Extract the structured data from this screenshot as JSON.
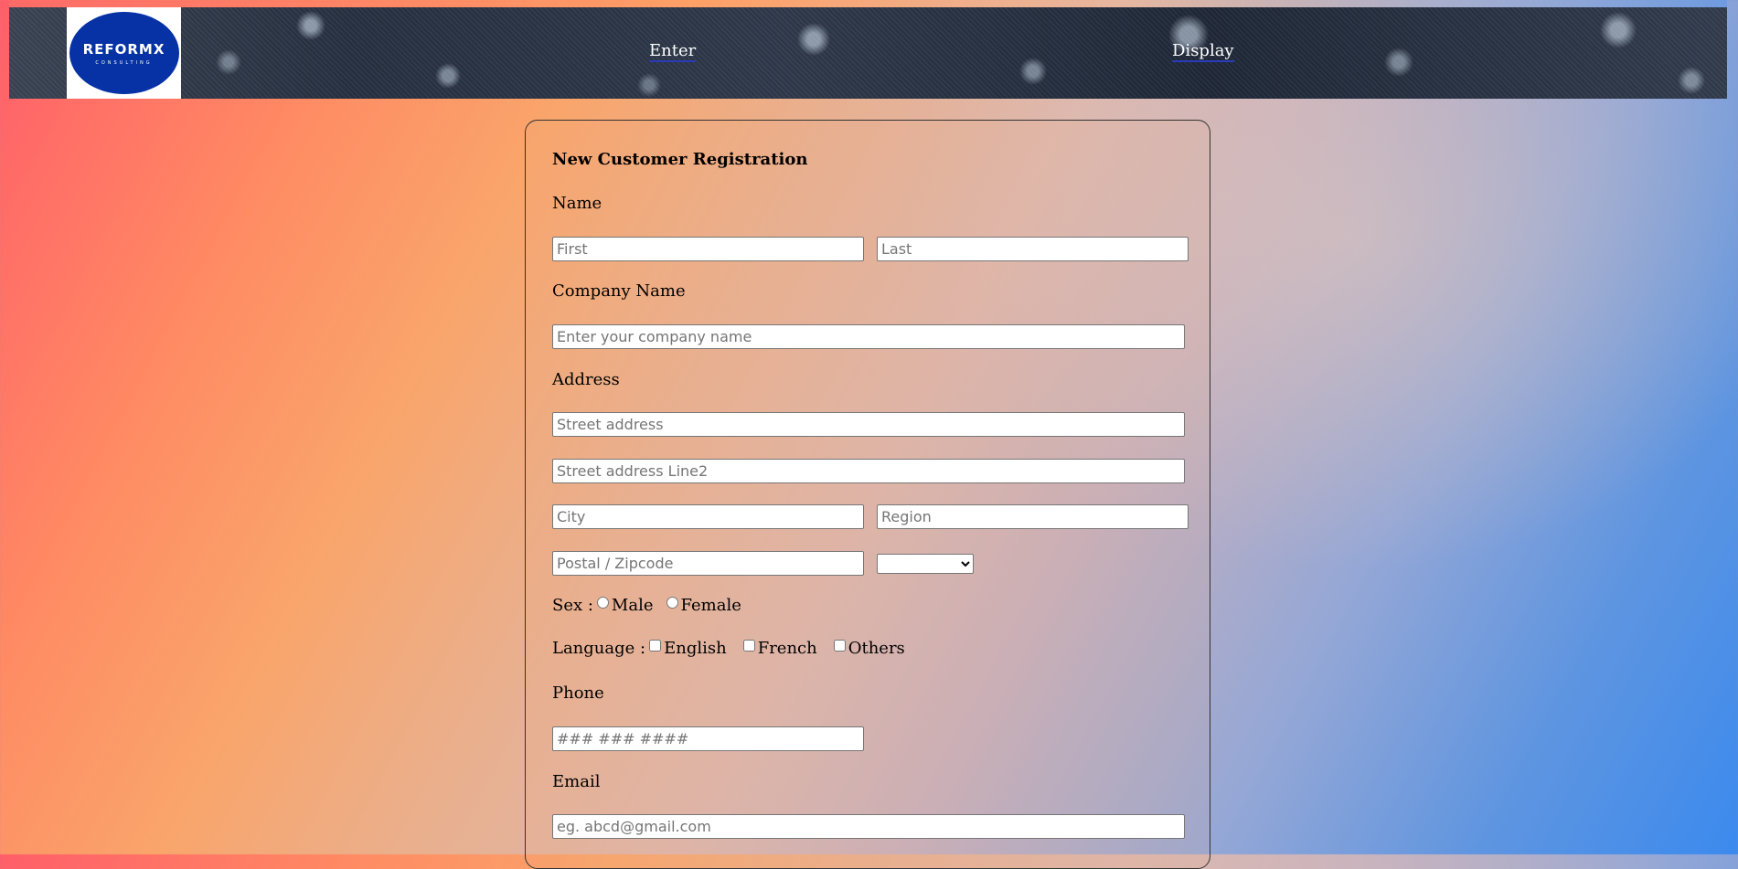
{
  "header": {
    "logo": {
      "main": "REFORMX",
      "sub": "CONSULTING"
    },
    "nav": [
      {
        "label": "Enter"
      },
      {
        "label": "Display"
      }
    ]
  },
  "form": {
    "title": "New Customer Registration",
    "name_label": "Name",
    "first_placeholder": "First",
    "last_placeholder": "Last",
    "company_label": "Company Name",
    "company_placeholder": "Enter your company name",
    "address_label": "Address",
    "street1_placeholder": "Street address",
    "street2_placeholder": "Street address Line2",
    "city_placeholder": "City",
    "region_placeholder": "Region",
    "postal_placeholder": "Postal / Zipcode",
    "country_selected": "",
    "sex_label": "Sex :",
    "sex_options": [
      "Male",
      "Female"
    ],
    "language_label": "Language :",
    "language_options": [
      "English",
      "French",
      "Others"
    ],
    "phone_label": "Phone",
    "phone_placeholder": "### ### ####",
    "email_label": "Email",
    "email_placeholder": "eg. abcd@gmail.com"
  },
  "colors": {
    "logo_blue": "#0632a6",
    "nav_underline": "#2a3ab8"
  }
}
